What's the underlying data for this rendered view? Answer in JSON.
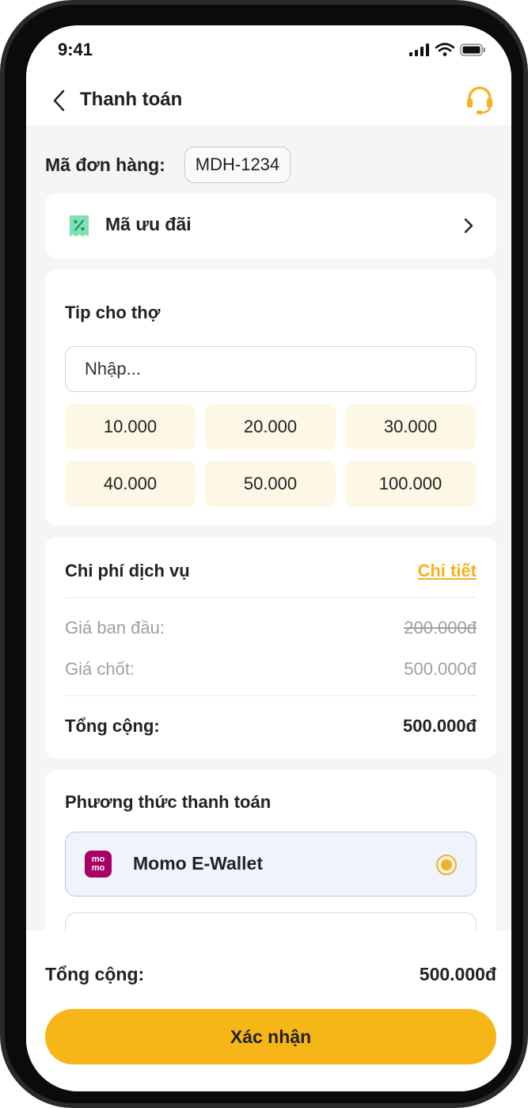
{
  "status_bar": {
    "time": "9:41",
    "icons": [
      "signal-icon",
      "wifi-icon",
      "battery-icon"
    ]
  },
  "header": {
    "title": "Thanh toán",
    "back_icon": "chevron-left-icon",
    "support_icon": "headset-icon"
  },
  "order": {
    "label": "Mã đơn hàng:",
    "code": "MDH-1234"
  },
  "voucher": {
    "label": "Mã ưu đãi",
    "icon": "discount-ticket-icon"
  },
  "tip": {
    "title": "Tip cho thợ",
    "placeholder": "Nhập...",
    "options": [
      "10.000",
      "20.000",
      "30.000",
      "40.000",
      "50.000",
      "100.000"
    ]
  },
  "cost": {
    "title": "Chi phí dịch vụ",
    "detail_link": "Chi tiết",
    "original_label": "Giá ban đầu:",
    "original_value": "200.000đ",
    "final_label": "Giá chốt:",
    "final_value": "500.000đ",
    "total_label": "Tổng cộng:",
    "total_value": "500.000đ"
  },
  "payment": {
    "title": "Phương thức thanh toán",
    "methods": [
      {
        "label": "Momo E-Wallet",
        "logo_top": "mo",
        "logo_bottom": "mo",
        "selected": true
      },
      {
        "label": "",
        "selected": false
      }
    ]
  },
  "footer": {
    "total_label": "Tổng cộng:",
    "total_value": "500.000đ",
    "confirm_label": "Xác nhận"
  },
  "colors": {
    "accent": "#F7B617",
    "momo": "#A50064",
    "background": "#F5F5F5",
    "tip_button": "#FDF7E6",
    "selected_method": "#EFF3FC"
  }
}
